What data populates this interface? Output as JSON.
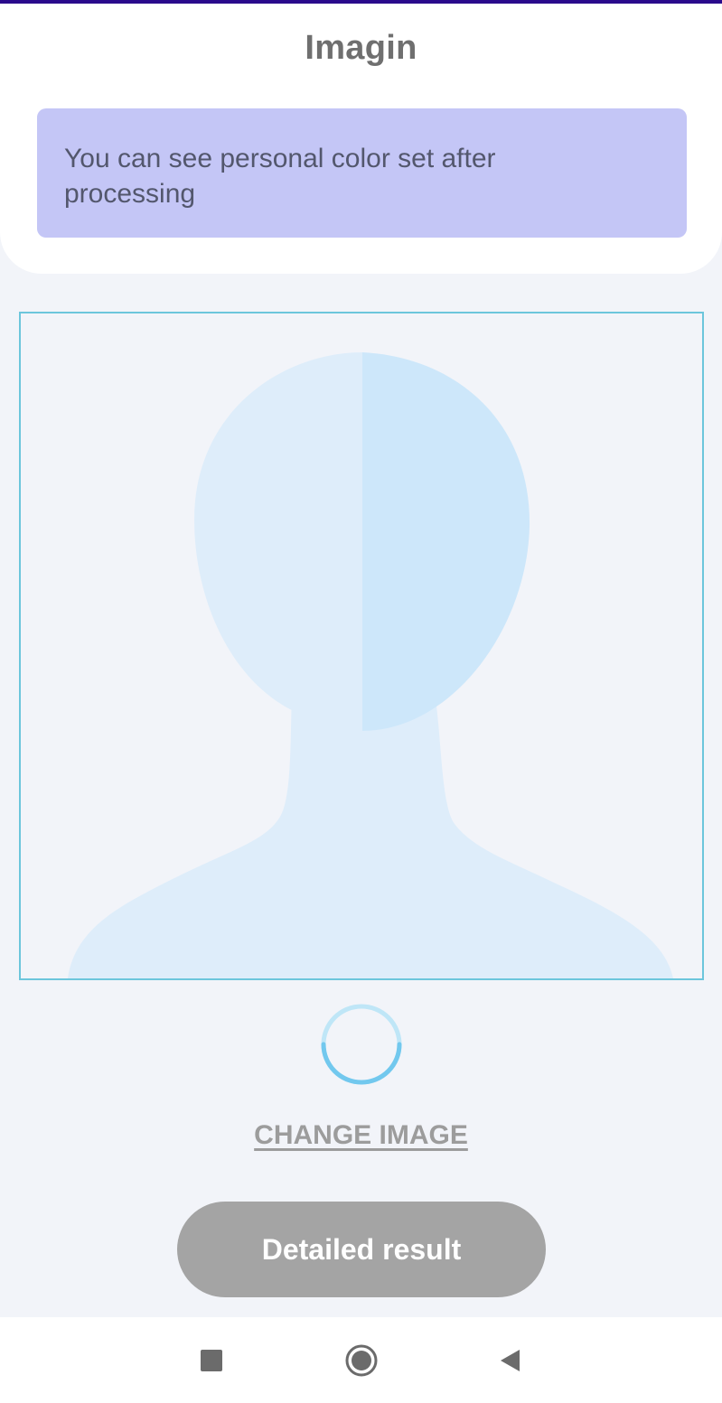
{
  "app": {
    "title": "Imagin"
  },
  "banner": {
    "text": "You can see personal color set after processing"
  },
  "actions": {
    "change_image_label": "CHANGE IMAGE",
    "detailed_result_label": "Detailed result"
  },
  "loading": {
    "indicator": "circular-spinner"
  },
  "nav": {
    "recents_icon": "square-icon",
    "home_icon": "circle-icon",
    "back_icon": "triangle-back-icon"
  },
  "colors": {
    "accent_top": "#2a0a8c",
    "banner_bg": "#c4c6f6",
    "frame_border": "#6cc6dc",
    "button_bg": "#a4a4a4",
    "placeholder_light": "#deedfa",
    "placeholder_dark": "#cde7fa"
  }
}
